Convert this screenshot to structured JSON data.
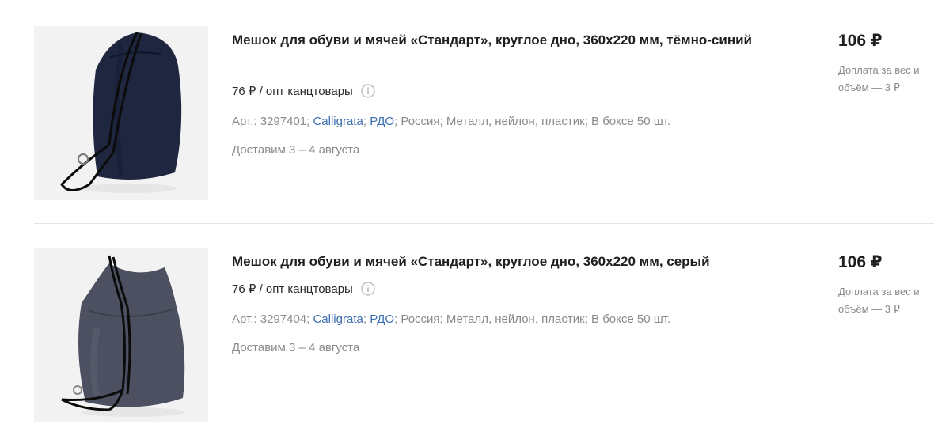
{
  "products": [
    {
      "title": "Мешок для обуви и мячей «Стандарт», круглое дно, 360х220 мм, тёмно-синий",
      "opt_price": "76 ₽ / опт канцтовары",
      "article": "Арт.: 3297401",
      "brand": "Calligrata",
      "brand_sep": ";",
      "supplier": "РДО",
      "supplier_sep": ";",
      "details": "Россия; Металл, нейлон, пластик; В боксе 50 шт.",
      "delivery": "Доставим 3 – 4 августа",
      "price": "106 ₽",
      "surcharge": "Доплата за вес и объём — 3 ₽",
      "image_color": "#1f2740"
    },
    {
      "title": "Мешок для обуви и мячей «Стандарт», круглое дно, 360х220 мм, серый",
      "opt_price": "76 ₽ / опт канцтовары",
      "article": "Арт.: 3297404",
      "brand": "Calligrata",
      "brand_sep": ";",
      "supplier": "РДО",
      "supplier_sep": ";",
      "details": "Россия; Металл, нейлон, пластик; В боксе 50 шт.",
      "delivery": "Доставим 3 – 4 августа",
      "price": "106 ₽",
      "surcharge": "Доплата за вес и объём — 3 ₽",
      "image_color": "#4c5060"
    }
  ],
  "colors": {
    "link": "#3b6fb0",
    "muted": "#8a8a8a",
    "text": "#1f1f1f",
    "divider": "#e4e4e4"
  }
}
